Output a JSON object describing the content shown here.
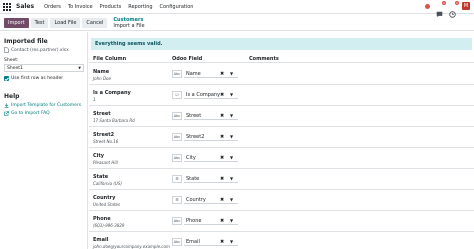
{
  "topbar": {
    "app_name": "Sales",
    "menu": [
      "Orders",
      "To Invoice",
      "Products",
      "Reporting",
      "Configuration"
    ],
    "chat_badge": "1",
    "activity_badge": "2",
    "avatar_letter": "M"
  },
  "control": {
    "import_label": "Import",
    "test_label": "Test",
    "load_file_label": "Load File",
    "cancel_label": "Cancel",
    "breadcrumb_parent": "Customers",
    "breadcrumb_current": "Import a File"
  },
  "sidebar": {
    "imported_file_heading": "Imported file",
    "file_name": "Contact (res.partner).xlsx",
    "sheet_label": "Sheet:",
    "sheet_value": "Sheet1",
    "first_row_header_label": "Use first row as header",
    "help_heading": "Help",
    "help_links": [
      "Import Template for Customers",
      "Go to Import FAQ"
    ]
  },
  "main": {
    "alert_text": "Everything seems valid.",
    "headers": {
      "file_column": "File Column",
      "odoo_field": "Odoo Field",
      "comments": "Comments"
    },
    "rows": [
      {
        "name": "Name",
        "sample": "John Doe",
        "type_icon": "Abc",
        "field": "Name"
      },
      {
        "name": "Is a Company",
        "sample": "1",
        "type_icon": "☑",
        "field": "Is a Company"
      },
      {
        "name": "Street",
        "sample": "17 Santa Barbara Rd",
        "type_icon": "Abc",
        "field": "Street"
      },
      {
        "name": "Street2",
        "sample": "Street No.16",
        "type_icon": "Abc",
        "field": "Street2"
      },
      {
        "name": "City",
        "sample": "Pleasant Hill",
        "type_icon": "Abc",
        "field": "City"
      },
      {
        "name": "State",
        "sample": "California (US)",
        "type_icon": "☰",
        "field": "State"
      },
      {
        "name": "Country",
        "sample": "United States",
        "type_icon": "☰",
        "field": "Country"
      },
      {
        "name": "Phone",
        "sample": "(603)-996-3829",
        "type_icon": "Abc",
        "field": "Phone"
      },
      {
        "name": "Email",
        "sample": "john.doe@yourcompany.example.com",
        "type_icon": "Abc",
        "field": "Email"
      }
    ]
  }
}
